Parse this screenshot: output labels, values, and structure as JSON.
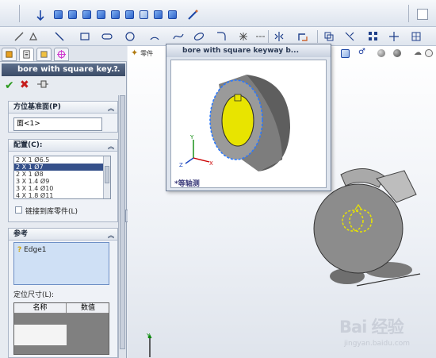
{
  "toolbar_top": {
    "icons": [
      "standard-views-icon",
      "view-orientation-cube-icons",
      "line-icon"
    ]
  },
  "toolbar_sketch": {
    "icons": [
      "smart-dimension-icon",
      "line-icon",
      "rectangle-icon",
      "slot-icon",
      "circle-icon",
      "arc-icon",
      "spline-icon",
      "ellipse-icon",
      "fillet-icon",
      "point-icon",
      "mirror-icon",
      "offset-icon",
      "pattern-icon",
      "move-icon"
    ]
  },
  "property_manager": {
    "title": "bore with square key...",
    "help": "?",
    "tabs": [
      "feature-manager",
      "property-manager",
      "configuration-manager",
      "dim-xpert"
    ],
    "actions": {
      "ok": "✔",
      "cancel": "✖"
    },
    "orientation_group": {
      "header": "方位基准面(P)",
      "value": "面<1>"
    },
    "config_group": {
      "header": "配置(C):",
      "items": [
        "2 X 1  Ø6.5",
        "2 X 1  Ø7",
        "2 X 1  Ø8",
        "3 X 1.4  Ø9",
        "3 X 1.4  Ø10",
        "4 X 1.8  Ø11"
      ],
      "selected_index": 1,
      "link_checkbox": "链接到库零件(L)"
    },
    "reference_group": {
      "header": "参考",
      "items": [
        "Edge1"
      ],
      "locate_label": "定位尺寸(L):",
      "table_headers": [
        "名称",
        "数值"
      ]
    }
  },
  "graphics": {
    "part_label": "零件",
    "preview": {
      "title": "bore with square keyway b...",
      "view_label": "*等轴测"
    }
  },
  "watermark": {
    "logo": "Bai 经验",
    "url": "jingyan.baidu.com"
  },
  "colors": {
    "accent": "#35508a",
    "part_face": "#e8e400",
    "part_body": "#8a8a8a",
    "highlight": "#2a78ff"
  }
}
